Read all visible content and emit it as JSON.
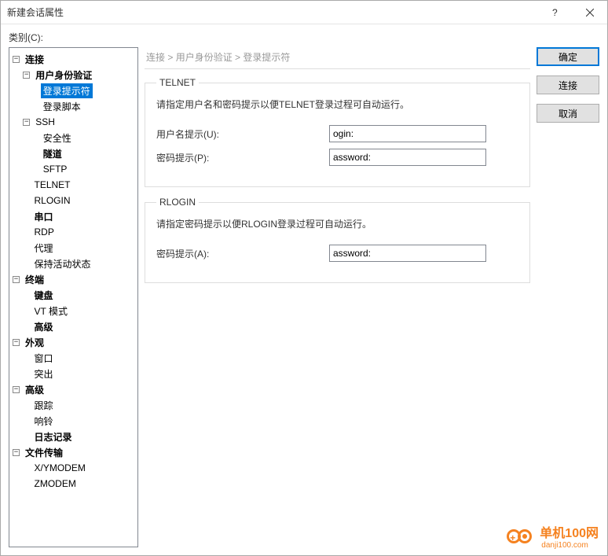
{
  "window": {
    "title": "新建会话属性"
  },
  "category_label": "类别(C):",
  "tree": {
    "connection": "连接",
    "user_auth": "用户身份验证",
    "login_prompt": "登录提示符",
    "login_script": "登录脚本",
    "ssh": "SSH",
    "security": "安全性",
    "tunnel": "隧道",
    "sftp": "SFTP",
    "telnet": "TELNET",
    "rlogin": "RLOGIN",
    "serial": "串口",
    "rdp": "RDP",
    "proxy": "代理",
    "keep_alive": "保持活动状态",
    "terminal": "终端",
    "keyboard": "键盘",
    "vt_mode": "VT 模式",
    "advanced_term": "高级",
    "appearance": "外观",
    "window": "窗口",
    "highlight": "突出",
    "advanced": "高级",
    "trace": "跟踪",
    "bell": "响铃",
    "logging": "日志记录",
    "file_transfer": "文件传输",
    "xymodem": "X/YMODEM",
    "zmodem": "ZMODEM"
  },
  "breadcrumb": {
    "a": "连接",
    "b": "用户身份验证",
    "c": "登录提示符",
    "sep": " > "
  },
  "telnet": {
    "legend": "TELNET",
    "desc": "请指定用户名和密码提示以便TELNET登录过程可自动运行。",
    "user_label": "用户名提示(U):",
    "user_value": "ogin:",
    "pass_label": "密码提示(P):",
    "pass_value": "assword:"
  },
  "rlogin": {
    "legend": "RLOGIN",
    "desc": "请指定密码提示以便RLOGIN登录过程可自动运行。",
    "pass_label": "密码提示(A):",
    "pass_value": "assword:"
  },
  "buttons": {
    "ok": "确定",
    "connect": "连接",
    "cancel": "取消"
  },
  "watermark": {
    "name": "单机100网",
    "url": "danji100.com"
  }
}
